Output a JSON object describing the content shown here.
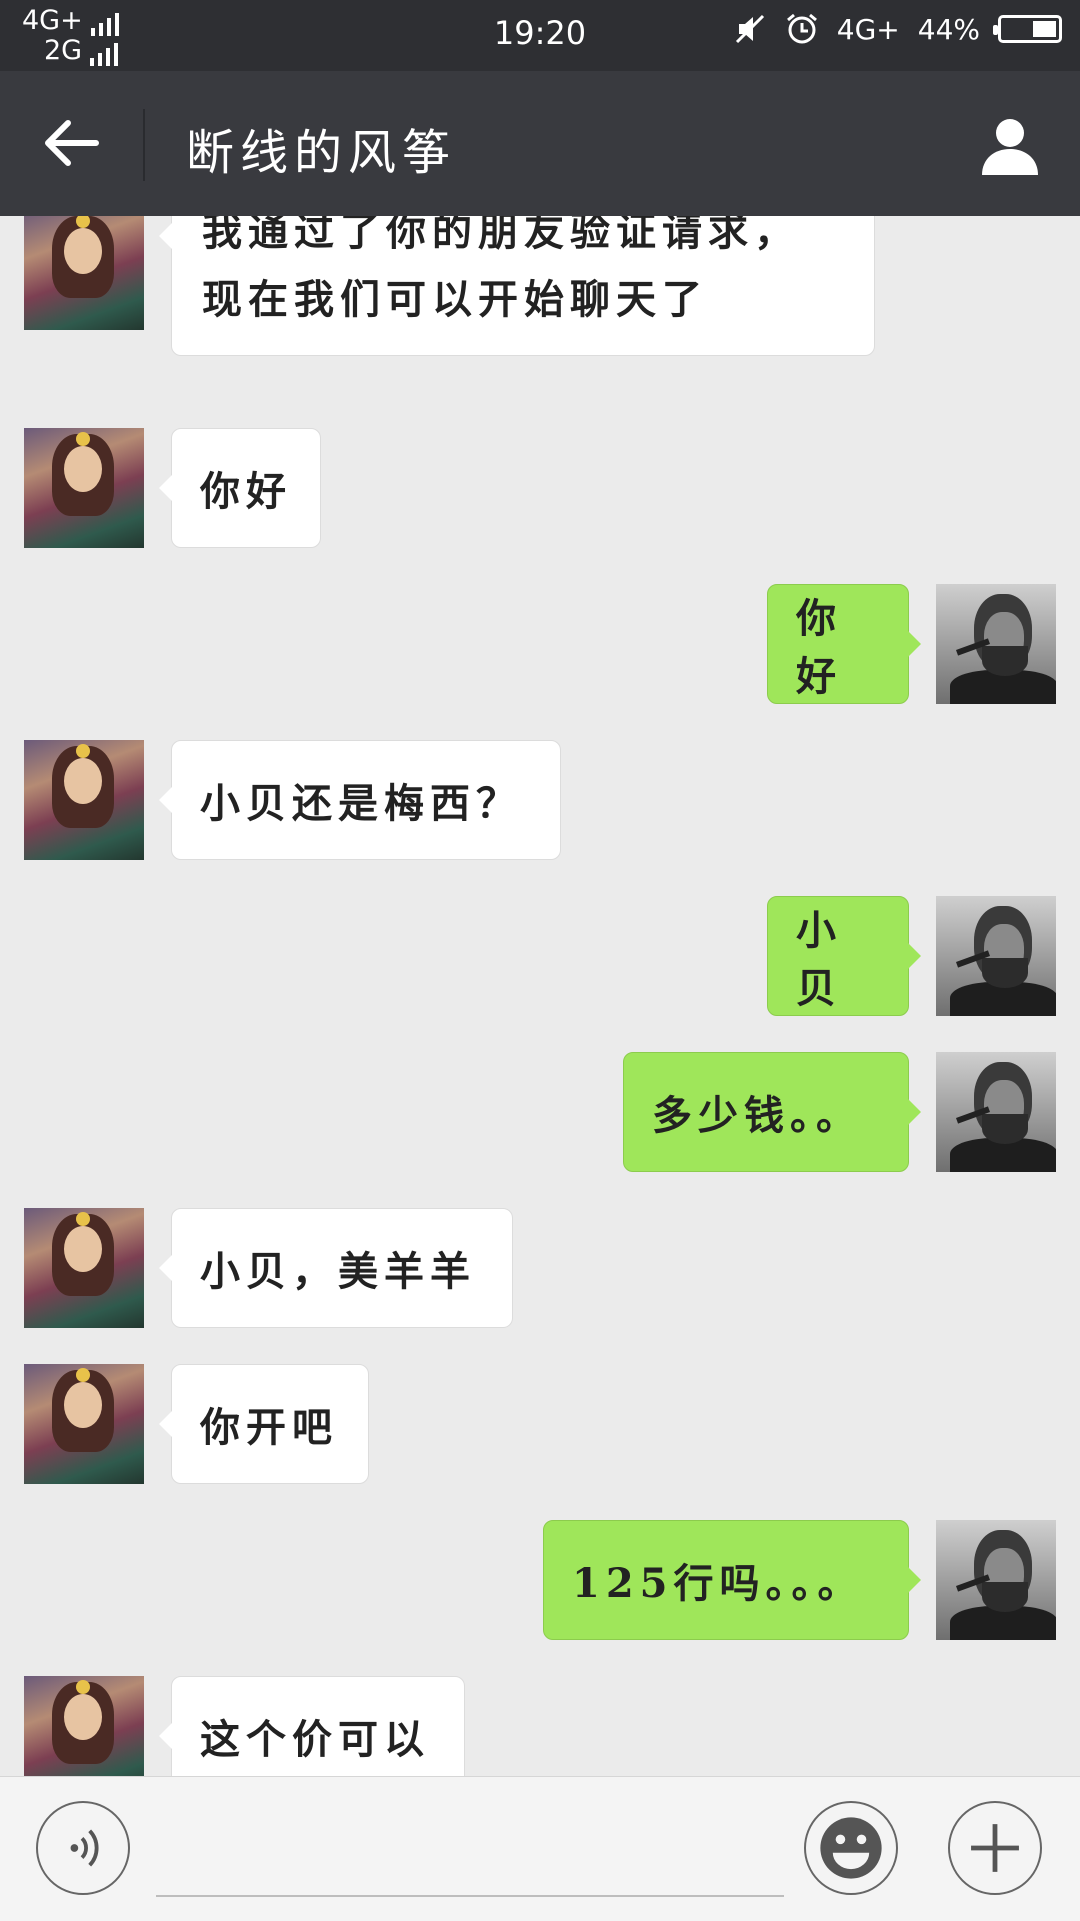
{
  "status_bar": {
    "network_1": "4G+",
    "network_2": "2G",
    "time": "19:20",
    "network_right": "4G+",
    "battery": "44%",
    "battery_level": 0.44
  },
  "header": {
    "title": "断线的风筝"
  },
  "messages": [
    {
      "from": "contact",
      "text_lines": [
        "我通过了你的朋友验证请求，",
        "现在我们可以开始聊天了"
      ]
    },
    {
      "from": "contact",
      "text": "你好"
    },
    {
      "from": "me",
      "text": "你好"
    },
    {
      "from": "contact",
      "text": "小贝还是梅西？"
    },
    {
      "from": "me",
      "text": "小贝"
    },
    {
      "from": "me",
      "text": "多少钱。。"
    },
    {
      "from": "contact",
      "text": "小贝，美羊羊"
    },
    {
      "from": "contact",
      "text": "你开吧"
    },
    {
      "from": "me",
      "text": "125行吗。。。"
    },
    {
      "from": "contact",
      "text": "这个价可以"
    }
  ],
  "input": {
    "value": "",
    "placeholder": ""
  },
  "colors": {
    "sent_bubble": "#9fe65a",
    "received_bubble": "#ffffff",
    "header_bg": "#393a3f"
  }
}
